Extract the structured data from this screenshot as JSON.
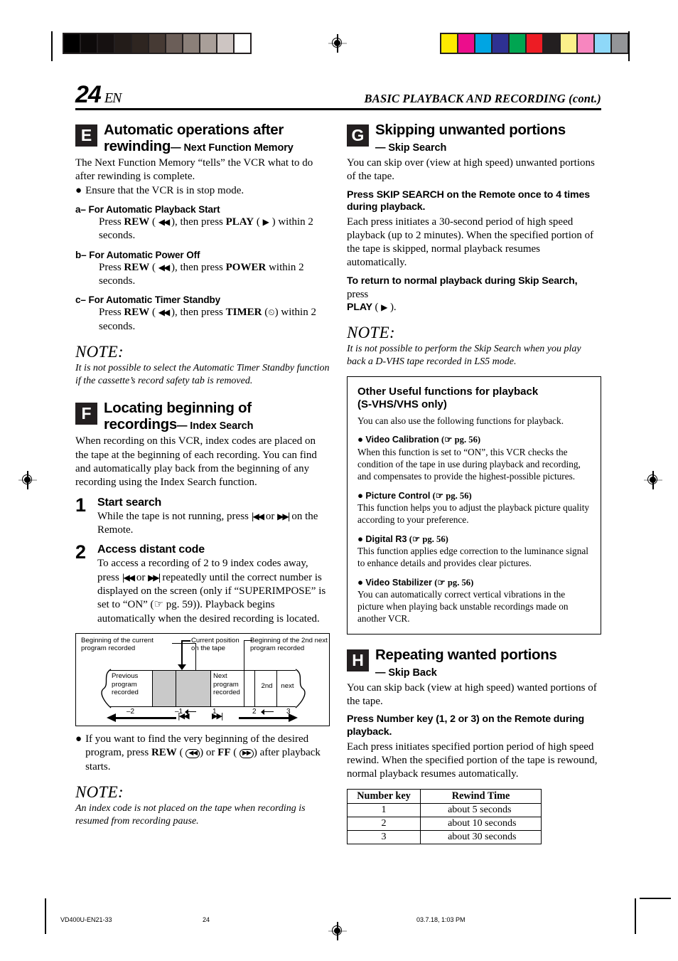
{
  "header": {
    "page_number": "24",
    "lang_code": "EN",
    "running_head": "BASIC PLAYBACK AND RECORDING (cont.)"
  },
  "calibration": {
    "gray_patches": [
      "#000000",
      "#0d0a0a",
      "#161111",
      "#231c19",
      "#2e2520",
      "#463a34",
      "#6b5e58",
      "#8b8079",
      "#a99f99",
      "#cdc5c2",
      "#ffffff"
    ],
    "color_patches": [
      "#fdea00",
      "#ec0d8c",
      "#00a5e3",
      "#2e3192",
      "#00a551",
      "#ed1c24",
      "#231f20",
      "#fbf08a",
      "#f craft",
      "#8ed8f8",
      "#939598"
    ],
    "color_patches_fixed": [
      "#fdea00",
      "#ec0d8c",
      "#00a5e3",
      "#2e3192",
      "#00a551",
      "#ed1c24",
      "#231f20",
      "#fbf08a",
      "#f786bf",
      "#8ed8f8",
      "#939598"
    ]
  },
  "left_column": {
    "section_e": {
      "letter": "E",
      "title_line1": "Automatic operations after",
      "title_line2": "rewinding",
      "subtitle": "— Next Function Memory",
      "intro": "The Next Function Memory “tells” the VCR what to do after rewinding is complete.",
      "bullet": "Ensure that the VCR is in stop mode.",
      "items": [
        {
          "label": "a– For Automatic Playback Start",
          "body_pre": "Press ",
          "key1": "REW",
          "glyph1": "◀◀",
          "mid": ", then press ",
          "key2": "PLAY",
          "glyph2": "▶",
          "body_post": " within 2 seconds."
        },
        {
          "label": "b– For Automatic Power Off",
          "body_pre": "Press ",
          "key1": "REW",
          "glyph1": "◀◀",
          "mid": ", then press ",
          "key2": "POWER",
          "glyph2": "",
          "body_post": " within 2 seconds."
        },
        {
          "label": "c– For Automatic Timer Standby",
          "body_pre": "Press ",
          "key1": "REW",
          "glyph1": "◀◀",
          "mid": ", then press ",
          "key2": "TIMER",
          "glyph2": "⏲",
          "body_post": " within 2 seconds."
        }
      ],
      "note_title": "NOTE:",
      "note_body": "It is not possible to select the Automatic Timer Standby function if the cassette’s record safety tab is removed."
    },
    "section_f": {
      "letter": "F",
      "title_line1": "Locating beginning of",
      "title_line2": "recordings",
      "subtitle": "— Index Search",
      "intro": "When recording on this VCR, index codes are placed on the tape at the beginning of each recording. You can find and automatically play back from the beginning of any recording using the Index Search function.",
      "steps": [
        {
          "number": "1",
          "title": "Start search",
          "body_pre": "While the tape is not running, press ",
          "glyph_a": "◀◀",
          "between": " or ",
          "glyph_b": "▶▶",
          "body_post": "  on the Remote."
        },
        {
          "number": "2",
          "title": "Access distant code",
          "body_pre": "To access a recording of 2 to 9 index codes away, press ",
          "glyph_a": "◀◀",
          "between": " or ",
          "glyph_b": "▶▶",
          "body_post": " repeatedly until the correct number is displayed on the screen (only if “SUPERIMPOSE” is set to “ON” (☞ pg. 59)). Playback begins automatically when the desired recording is located."
        }
      ],
      "bullet_after_diagram_pre": "If you want to find the very beginning of the desired program, press ",
      "bullet_key1": "REW",
      "bullet_key1_glyph": "◀◀",
      "bullet_mid": ") or ",
      "bullet_key2": "FF",
      "bullet_key2_glyph": "▶▶",
      "bullet_post": ") after playback starts.",
      "note_title": "NOTE:",
      "note_body": "An index code is not placed on the tape when recording is resumed from recording pause."
    },
    "diagram": {
      "callout_left_line1": "Beginning of the current",
      "callout_left_line2": "program recorded",
      "callout_mid_line1": "Current position",
      "callout_mid_line2": "on the tape",
      "callout_right_line1": "Beginning of the 2nd next",
      "callout_right_line2": "program recorded",
      "segments": [
        {
          "label": "Previous\nprogram\nrecorded",
          "shaded": false
        },
        {
          "label": "",
          "shaded": true
        },
        {
          "label": "",
          "shaded": true
        },
        {
          "label": "Next\nprogram\nrecorded",
          "shaded": false
        },
        {
          "label": "2nd",
          "shaded": false
        },
        {
          "label": "next",
          "shaded": false
        }
      ],
      "segment_text": [
        "Previous program recorded",
        "Next program recorded",
        "2nd",
        "next"
      ],
      "scale_marks": [
        "–2",
        "–1",
        "1",
        "2",
        "3"
      ],
      "rew_glyph": "|◀◀",
      "ff_glyph": "▶▶|"
    }
  },
  "right_column": {
    "section_g": {
      "letter": "G",
      "title": "Skipping unwanted portions",
      "subtitle": "— Skip Search",
      "intro": "You can skip over (view at high speed) unwanted portions of the tape.",
      "lead1": "Press SKIP SEARCH on the Remote once to 4 times during playback.",
      "body1": "Each press initiates a 30-second period of high speed playback (up to 2 minutes). When the specified portion of the tape is skipped, normal playback resumes automatically.",
      "lead2": "To return to normal playback during Skip Search,",
      "lead2_tail": " press ",
      "lead2_key": "PLAY",
      "lead2_glyph": "▶",
      "lead2_end": " ).",
      "note_title": "NOTE:",
      "note_body": "It is not possible to perform the Skip Search when you play back a D-VHS tape recorded in LS5 mode."
    },
    "framed_box": {
      "title_line1": "Other Useful functions for playback",
      "title_line2": "(S-VHS/VHS only)",
      "intro": "You can also use the following functions for playback.",
      "items": [
        {
          "name": "Video Calibration",
          "ref": "(☞ pg. 56)",
          "body": "When this function is set to “ON”, this VCR checks the condition of the tape in use during playback and recording, and compensates to provide the highest-possible pictures."
        },
        {
          "name": "Picture Control",
          "ref": "(☞ pg. 56)",
          "body": "This function helps you to adjust the playback picture quality according to your preference."
        },
        {
          "name": "Digital R3",
          "ref": "(☞ pg. 56)",
          "body": "This function applies edge correction to the luminance signal to enhance details and provides clear pictures."
        },
        {
          "name": "Video Stabilizer",
          "ref": "(☞ pg. 56)",
          "body": "You can automatically correct vertical vibrations in the picture when playing back unstable recordings made on another VCR."
        }
      ]
    },
    "section_h": {
      "letter": "H",
      "title": "Repeating wanted portions",
      "subtitle": "— Skip Back",
      "intro": "You can skip back (view at high speed) wanted portions of the tape.",
      "lead1": "Press Number key (1, 2 or 3) on the Remote during playback.",
      "body1": "Each press initiates specified portion period of high speed rewind. When the specified portion of the tape is rewound, normal playback resumes automatically."
    },
    "rewind_table": {
      "headers": [
        "Number key",
        "Rewind Time"
      ],
      "rows": [
        [
          "1",
          "about   5 seconds"
        ],
        [
          "2",
          "about 10 seconds"
        ],
        [
          "3",
          "about 30 seconds"
        ]
      ]
    }
  },
  "footer": {
    "doc_code": "VD400U-EN21-33",
    "page": "24",
    "timestamp": "03.7.18, 1:03 PM"
  }
}
